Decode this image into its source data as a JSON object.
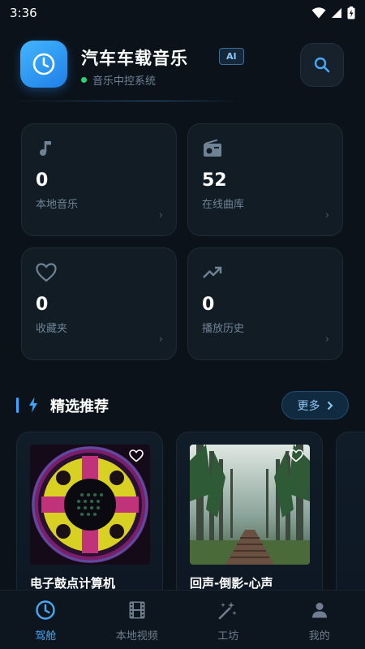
{
  "status_bar": {
    "time": "3:36"
  },
  "header": {
    "title": "汽车车载音乐",
    "badge": "AI",
    "subtitle": "音乐中控系统"
  },
  "stats": [
    {
      "icon": "music-note-icon",
      "value": "0",
      "label": "本地音乐"
    },
    {
      "icon": "radio-icon",
      "value": "52",
      "label": "在线曲库"
    },
    {
      "icon": "heart-icon",
      "value": "0",
      "label": "收藏夹"
    },
    {
      "icon": "trending-up-icon",
      "value": "0",
      "label": "播放历史"
    }
  ],
  "section": {
    "title": "精选推荐",
    "more_label": "更多"
  },
  "recommendations": [
    {
      "title": "电子鼓点计算机"
    },
    {
      "title": "回声-倒影-心声"
    }
  ],
  "tabs": [
    {
      "label": "驾舱",
      "icon": "clock-icon",
      "active": true
    },
    {
      "label": "本地视频",
      "icon": "film-icon",
      "active": false
    },
    {
      "label": "工坊",
      "icon": "magic-wand-icon",
      "active": false
    },
    {
      "label": "我的",
      "icon": "person-icon",
      "active": false
    }
  ],
  "colors": {
    "background": "#0b1219",
    "accent": "#49a8f5",
    "online_dot": "#2ed178"
  }
}
